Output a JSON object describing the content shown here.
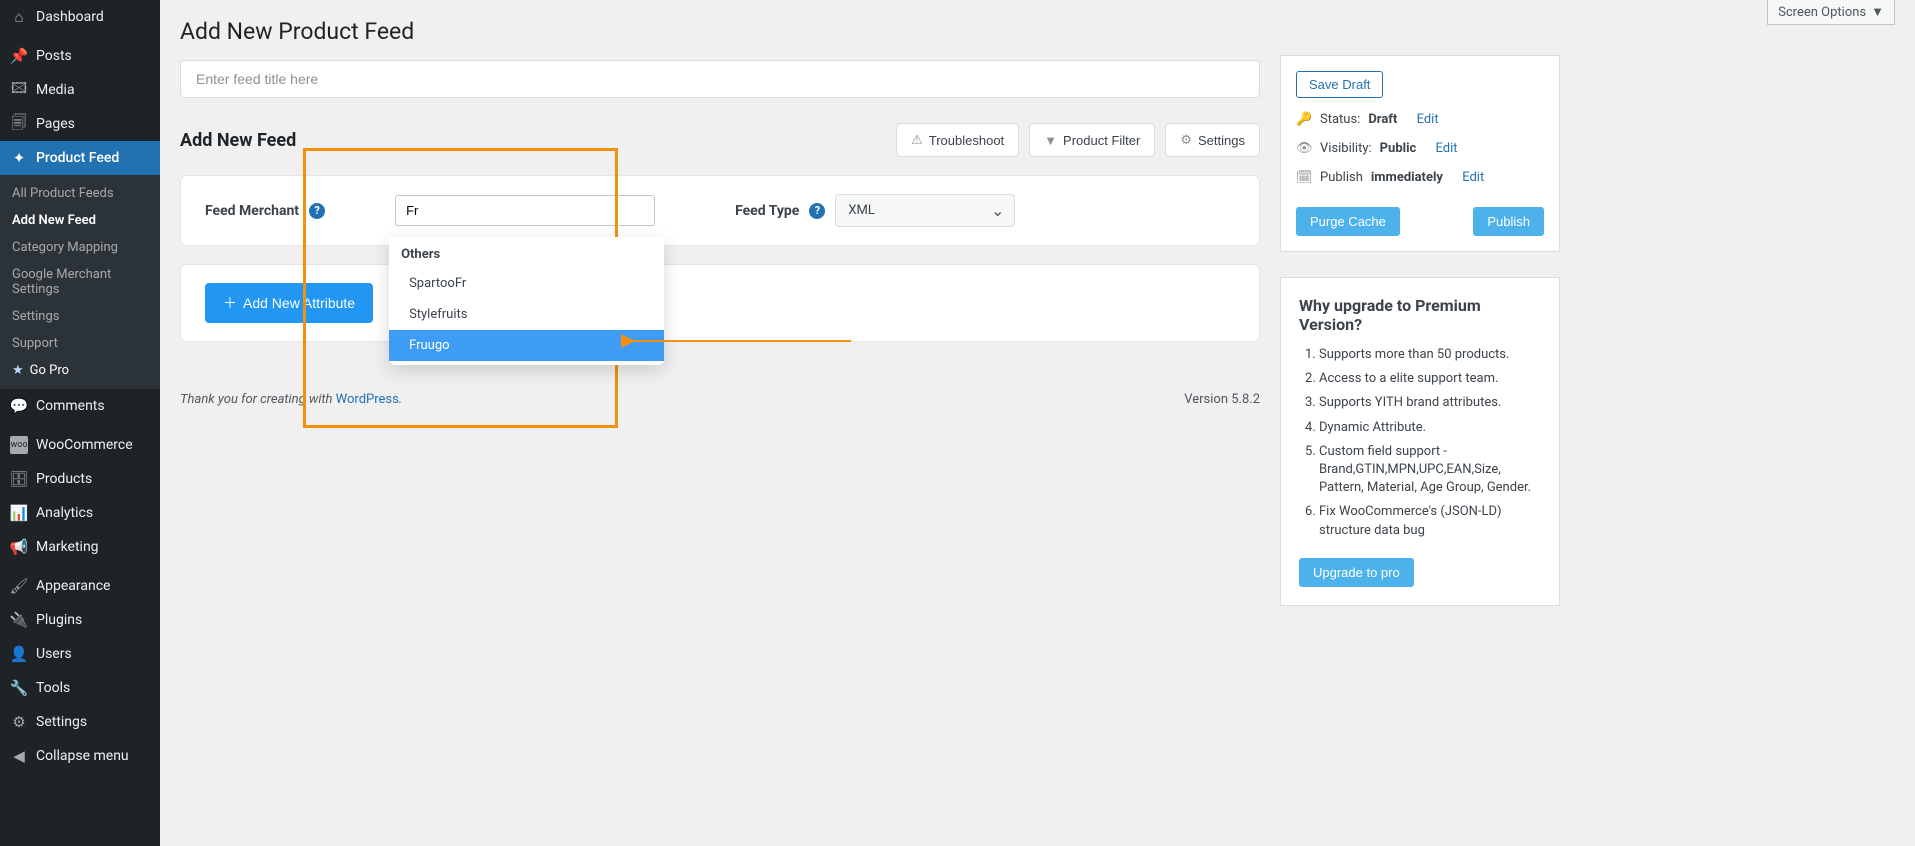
{
  "screen_options": "Screen Options",
  "sidebar": {
    "dashboard": "Dashboard",
    "posts": "Posts",
    "media": "Media",
    "pages": "Pages",
    "product_feed": "Product Feed",
    "sub": {
      "all": "All Product Feeds",
      "add": "Add New Feed",
      "category": "Category Mapping",
      "gms1": "Google Merchant",
      "gms2": "Settings",
      "settings": "Settings",
      "support": "Support",
      "gopro": "Go Pro"
    },
    "comments": "Comments",
    "woocommerce": "WooCommerce",
    "products": "Products",
    "analytics": "Analytics",
    "marketing": "Marketing",
    "appearance": "Appearance",
    "plugins": "Plugins",
    "users": "Users",
    "tools": "Tools",
    "settings": "Settings",
    "collapse": "Collapse menu"
  },
  "page": {
    "title": "Add New Product Feed",
    "title_placeholder": "Enter feed title here"
  },
  "feed": {
    "heading": "Add New Feed",
    "troubleshoot": "Troubleshoot",
    "product_filter": "Product Filter",
    "settings": "Settings",
    "merchant_label": "Feed Merchant",
    "type_label": "Feed Type",
    "type_value": "XML",
    "search_value": "Fr",
    "dd_group": "Others",
    "dd_spartoo": "SpartooFr",
    "dd_stylefruits": "Stylefruits",
    "dd_fruugo": "Fruugo",
    "add_attr": "Add New Attribute"
  },
  "publish": {
    "save_draft": "Save Draft",
    "status_label": "Status: ",
    "status_value": "Draft",
    "visibility_label": "Visibility: ",
    "visibility_value": "Public",
    "publish_label": "Publish ",
    "publish_value": "immediately",
    "edit": "Edit",
    "purge": "Purge Cache",
    "publish": "Publish"
  },
  "premium": {
    "title": "Why upgrade to Premium Version?",
    "i1": "Supports more than 50 products.",
    "i2": "Access to a elite support team.",
    "i3": "Supports YITH brand attributes.",
    "i4": "Dynamic Attribute.",
    "i5": "Custom field support - Brand,GTIN,MPN,UPC,EAN,Size, Pattern, Material, Age Group, Gender.",
    "i6": "Fix WooCommerce's (JSON-LD) structure data bug",
    "upgrade": "Upgrade to pro"
  },
  "footer": {
    "thanks": "Thank you for creating with ",
    "wp": "WordPress",
    "period": ".",
    "version": "Version 5.8.2"
  }
}
